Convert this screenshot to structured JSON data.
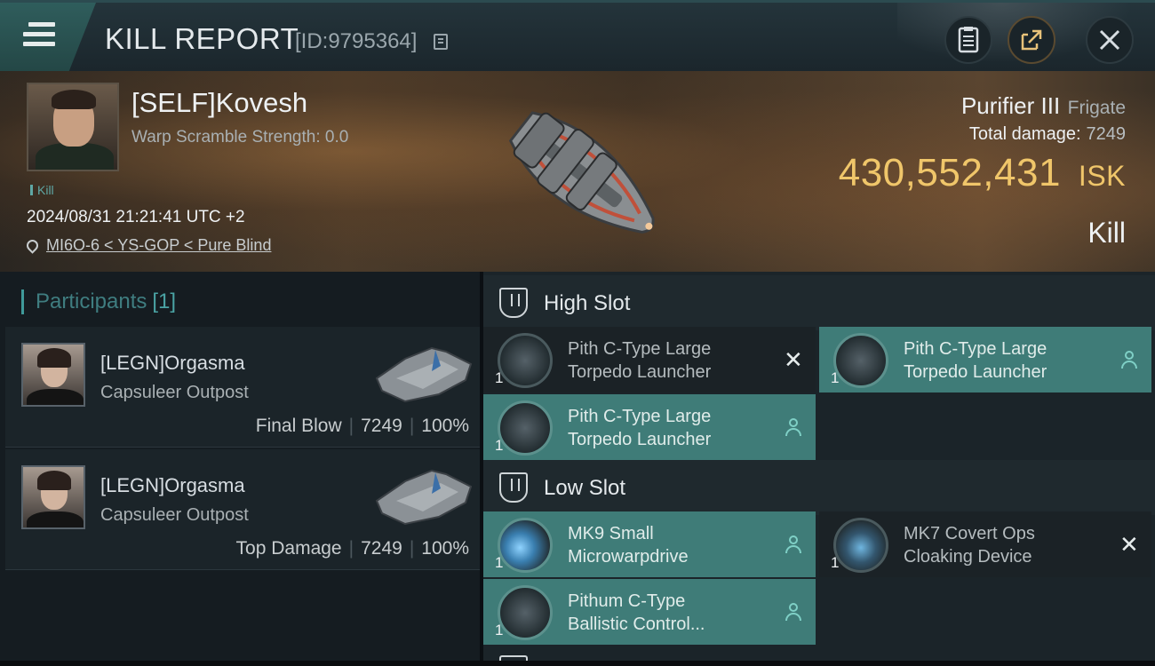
{
  "header": {
    "title": "KILL REPORT",
    "report_id": "[ID:9795364]",
    "buttons": [
      "notes-icon",
      "share-icon",
      "close-icon"
    ]
  },
  "victim": {
    "name": "[SELF]Kovesh",
    "warp_scramble": "Warp Scramble Strength: 0.0",
    "tag": "Kill",
    "datetime": "2024/08/31 21:21:41 UTC +2",
    "location": "MI6O-6 < YS-GOP < Pure Blind",
    "ship_name": "Purifier III",
    "ship_class": "Frigate",
    "total_damage_label": "Total damage:",
    "total_damage_value": "7249",
    "isk_value": "430,552,431",
    "isk_unit": "ISK",
    "result": "Kill"
  },
  "participants": {
    "title": "Participants",
    "count": "[1]",
    "items": [
      {
        "name": "[LEGN]Orgasma",
        "ship": "Capsuleer Outpost",
        "role": "Final Blow",
        "damage": "7249",
        "percent": "100%"
      },
      {
        "name": "[LEGN]Orgasma",
        "ship": "Capsuleer Outpost",
        "role": "Top Damage",
        "damage": "7249",
        "percent": "100%"
      }
    ]
  },
  "slots": {
    "high": {
      "title": "High Slot",
      "modules": [
        {
          "line1": "Pith C-Type Large",
          "line2": "Torpedo Launcher",
          "qty": "1",
          "status": "destroyed"
        },
        {
          "line1": "Pith C-Type Large",
          "line2": "Torpedo Launcher",
          "qty": "1",
          "status": "dropped"
        },
        {
          "line1": "Pith C-Type Large",
          "line2": "Torpedo Launcher",
          "qty": "1",
          "status": "dropped"
        }
      ]
    },
    "low": {
      "title": "Low Slot",
      "modules": [
        {
          "line1": "MK9 Small",
          "line2": "Microwarpdrive",
          "qty": "1",
          "status": "dropped"
        },
        {
          "line1": "MK7 Covert Ops",
          "line2": "Cloaking Device",
          "qty": "1",
          "status": "destroyed"
        },
        {
          "line1": "Pithum C-Type",
          "line2": "Ballistic Control...",
          "qty": "1",
          "status": "dropped"
        }
      ]
    }
  },
  "colors": {
    "accent": "#3f7c78",
    "isk": "#f0c66a",
    "participant_title": "#3f7d80"
  }
}
